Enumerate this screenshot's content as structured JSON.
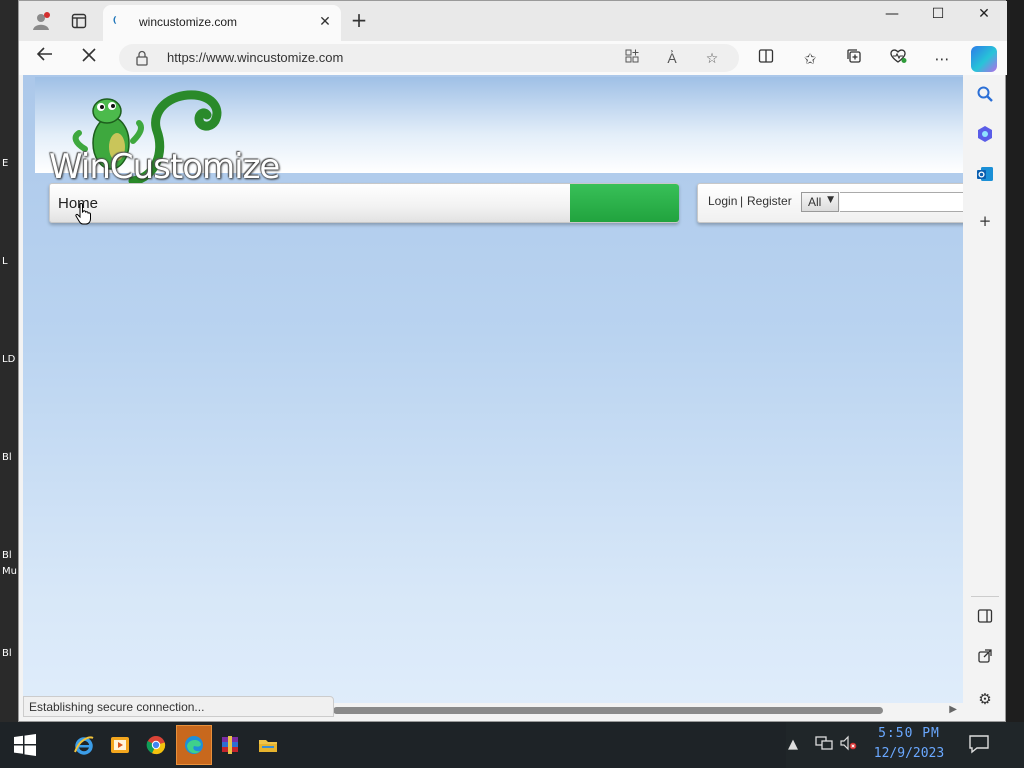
{
  "browser": {
    "tab_title": "wincustomize.com",
    "tab_close": "✕",
    "new_tab": "+",
    "url": "https://www.wincustomize.com",
    "status_text": "Establishing secure connection...",
    "window_controls": {
      "minimize": "—",
      "maximize": "☐",
      "close": "✕"
    }
  },
  "page": {
    "logo_text": "WinCustomize",
    "menu": {
      "home": "Home"
    },
    "account": {
      "login": "Login",
      "separator": "|",
      "register": "Register"
    },
    "search": {
      "scope_value": "All",
      "input_value": ""
    }
  },
  "desktop": {
    "left_fragments": [
      "E",
      "L",
      "LD",
      "Bl",
      "Bl",
      "Mu",
      "Bl"
    ]
  },
  "taskbar": {
    "time": "5:50 PM",
    "date": "12/9/2023"
  },
  "colors": {
    "accent_green": "#21a33e",
    "taskbar_clock": "#6aa8ff",
    "active_task": "#c8681d"
  },
  "icons": {
    "profile": "profile-icon",
    "tab_actions": "tab-actions-icon",
    "back": "back-arrow-icon",
    "stop": "stop-loading-icon",
    "lock": "lock-icon",
    "apps": "app-available-icon",
    "read_aloud": "read-aloud-icon",
    "favorite": "favorite-star-icon",
    "split": "split-screen-icon",
    "favorites": "favorites-icon",
    "collections": "collections-icon",
    "performance": "browser-essentials-icon",
    "more": "more-icon",
    "copilot": "copilot-icon"
  }
}
